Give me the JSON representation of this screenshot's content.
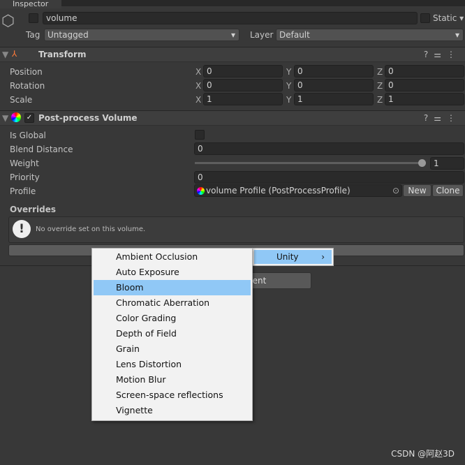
{
  "tab": "Inspector",
  "object": {
    "name": "volume",
    "static_label": "Static",
    "tag_label": "Tag",
    "tag": "Untagged",
    "layer_label": "Layer",
    "layer": "Default"
  },
  "transform": {
    "title": "Transform",
    "rows": [
      {
        "label": "Position",
        "x": "0",
        "y": "0",
        "z": "0"
      },
      {
        "label": "Rotation",
        "x": "0",
        "y": "0",
        "z": "0"
      },
      {
        "label": "Scale",
        "x": "1",
        "y": "1",
        "z": "1"
      }
    ],
    "axes": {
      "x": "X",
      "y": "Y",
      "z": "Z"
    }
  },
  "volume": {
    "title": "Post-process Volume",
    "enabled": true,
    "is_global_label": "Is Global",
    "is_global": false,
    "blend_label": "Blend Distance",
    "blend": "0",
    "weight_label": "Weight",
    "weight": "1",
    "priority_label": "Priority",
    "priority": "0",
    "profile_label": "Profile",
    "profile": "volume Profile (PostProcessProfile)",
    "new_label": "New",
    "clone_label": "Clone",
    "overrides_label": "Overrides",
    "no_override": "No override set on this volume."
  },
  "add_component": "Add Component",
  "menu": {
    "items": [
      "Ambient Occlusion",
      "Auto Exposure",
      "Bloom",
      "Chromatic Aberration",
      "Color Grading",
      "Depth of Field",
      "Grain",
      "Lens Distortion",
      "Motion Blur",
      "Screen-space reflections",
      "Vignette"
    ],
    "selected": "Bloom",
    "submenu": "Unity"
  },
  "watermark": "CSDN @阿赵3D"
}
